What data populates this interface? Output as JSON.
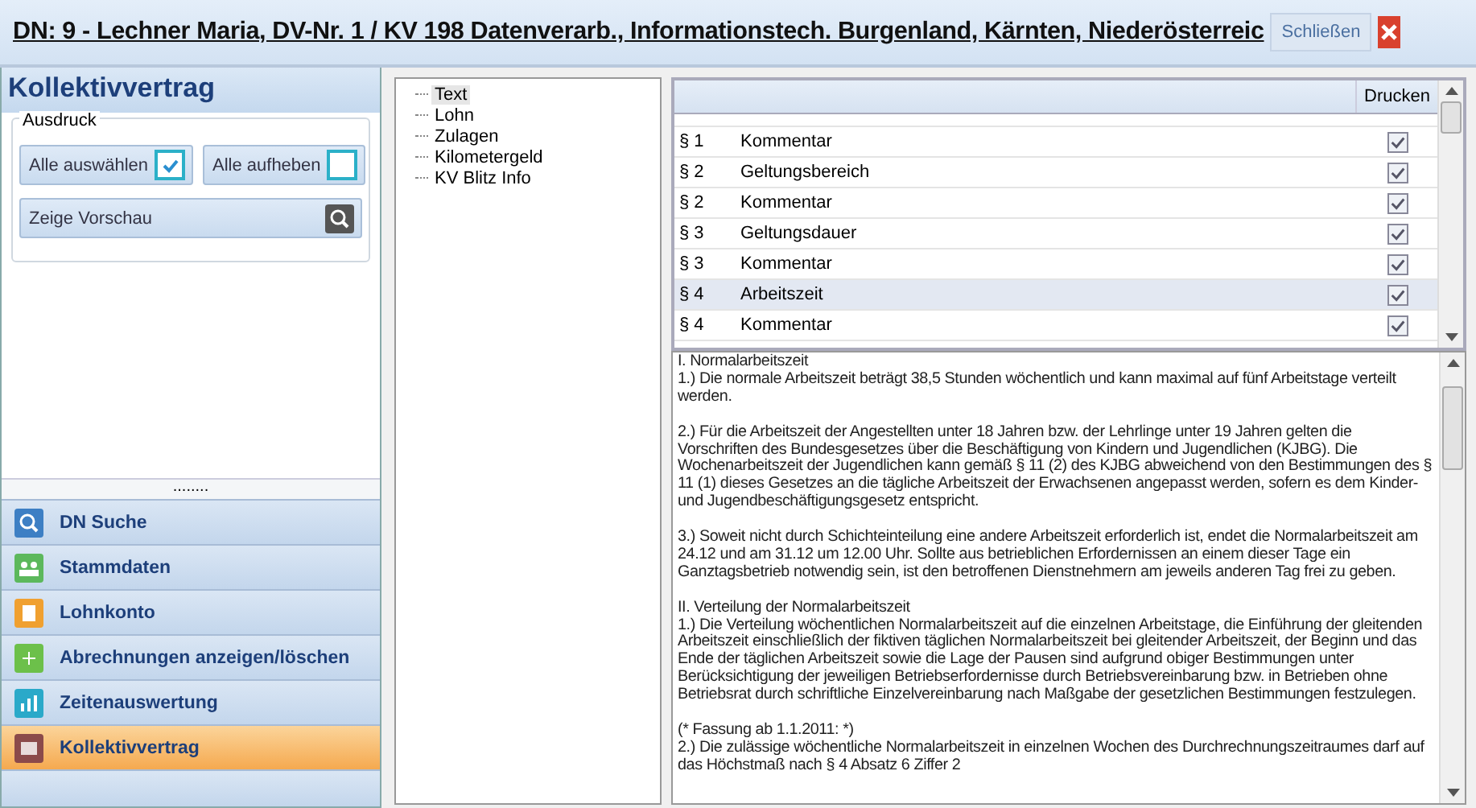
{
  "header": {
    "title": "DN: 9 - Lechner Maria, DV-Nr. 1 / KV 198 Datenverarb., Informationstech. Burgenland, Kärnten, Niederösterreic",
    "close_label": "Schließen"
  },
  "sidebar": {
    "title": "Kollektivvertrag",
    "group_label": "Ausdruck",
    "buttons": [
      {
        "kind": "checkbox",
        "label": "Alle auswählen",
        "checked": true
      },
      {
        "kind": "checkbox",
        "label": "Alle aufheben",
        "checked": false
      },
      {
        "kind": "preview",
        "label": "Zeige Vorschau"
      }
    ],
    "splitter": "........",
    "nav_items": [
      {
        "label": "DN Suche",
        "selected": false
      },
      {
        "label": "Stammdaten",
        "selected": false
      },
      {
        "label": "Lohnkonto",
        "selected": false
      },
      {
        "label": "Abrechnungen anzeigen/löschen",
        "selected": false
      },
      {
        "label": "Zeitenauswertung",
        "selected": false
      },
      {
        "label": "Kollektivvertrag",
        "selected": true
      }
    ]
  },
  "tree": {
    "items": [
      {
        "label": "Text",
        "selected": true
      },
      {
        "label": "Lohn",
        "selected": false
      },
      {
        "label": "Zulagen",
        "selected": false
      },
      {
        "label": "Kilometergeld",
        "selected": false
      },
      {
        "label": "KV Blitz Info",
        "selected": false
      }
    ]
  },
  "table": {
    "columns": [
      "Drucken"
    ],
    "rows": [
      {
        "section": "§ 1",
        "title": "Kommentar",
        "print": true,
        "selected": false
      },
      {
        "section": "§ 2",
        "title": "Geltungsbereich",
        "print": true,
        "selected": false
      },
      {
        "section": "§ 2",
        "title": "Kommentar",
        "print": true,
        "selected": false
      },
      {
        "section": "§ 3",
        "title": "Geltungsdauer",
        "print": true,
        "selected": false
      },
      {
        "section": "§ 3",
        "title": "Kommentar",
        "print": true,
        "selected": false
      },
      {
        "section": "§ 4",
        "title": "Arbeitszeit",
        "print": true,
        "selected": true
      },
      {
        "section": "§ 4",
        "title": "Kommentar",
        "print": true,
        "selected": false
      }
    ]
  },
  "text": {
    "blocks": [
      [
        "I. Normalarbeitszeit",
        "1.) Die normale Arbeitszeit beträgt 38,5 Stunden wöchentlich und kann maximal auf fünf Arbeitstage verteilt werden."
      ],
      [
        "2.) Für die Arbeitszeit der Angestellten unter 18 Jahren bzw. der Lehrlinge unter 19 Jahren gelten die Vorschriften des Bundesgesetzes über die Beschäftigung von Kindern und Jugendlichen (KJBG). Die Wochenarbeitszeit der Jugendlichen kann gemäß § 11 (2) des KJBG abweichend von den Bestimmungen des § 11 (1) dieses Gesetzes an die tägliche Arbeitszeit der Erwachsenen angepasst werden, sofern es dem Kinder- und Jugendbeschäftigungsgesetz entspricht."
      ],
      [
        "3.) Soweit nicht durch Schichteinteilung eine andere Arbeitszeit erforderlich ist, endet die Normalarbeitszeit am 24.12 und am 31.12 um 12.00 Uhr. Sollte aus betrieblichen Erfordernissen an einem dieser Tage ein Ganztagsbetrieb notwendig sein, ist den betroffenen Dienstnehmern am jeweils anderen Tag frei zu geben."
      ],
      [
        "II. Verteilung der Normalarbeitszeit",
        "1.) Die Verteilung wöchentlichen Normalarbeitszeit auf die einzelnen Arbeitstage, die Einführung der gleitenden Arbeitszeit einschließlich der fiktiven täglichen Normalarbeitszeit bei gleitender Arbeitszeit, der Beginn und das Ende der täglichen Arbeitszeit sowie die Lage der Pausen sind aufgrund obiger Bestimmungen unter Berücksichtigung der jeweiligen Betriebserfordernisse durch Betriebsvereinbarung bzw. in Betrieben ohne Betriebsrat durch schriftliche Einzelvereinbarung nach Maßgabe der gesetzlichen Bestimmungen festzulegen."
      ],
      [
        "(* Fassung ab 1.1.2011: *)",
        "2.) Die zulässige wöchentliche Normalarbeitszeit in einzelnen Wochen des Durchrechnungszeitraumes darf auf das Höchstmaß nach § 4 Absatz 6 Ziffer 2"
      ]
    ]
  }
}
